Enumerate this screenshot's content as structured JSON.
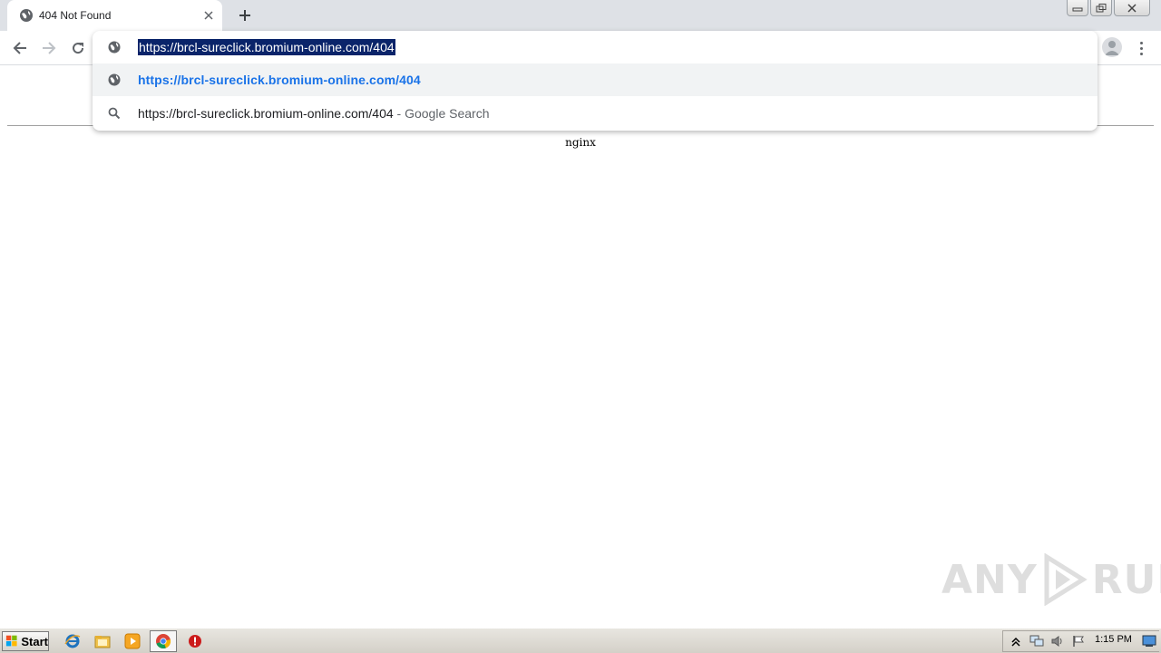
{
  "tab": {
    "title": "404 Not Found",
    "favicon": "globe-icon",
    "close_icon": "close-icon"
  },
  "newtab": {
    "icon": "plus-icon"
  },
  "window_controls": {
    "minimize": "minimize-icon",
    "restore": "restore-icon",
    "close": "close-icon"
  },
  "toolbar": {
    "back": "arrow-left-icon",
    "forward": "arrow-right-icon",
    "reload": "reload-icon",
    "avatar": "person-icon",
    "menu": "more-vertical-icon"
  },
  "omnibox": {
    "value": "https://brcl-sureclick.bromium-online.com/404",
    "suggestions": [
      {
        "icon": "globe-icon",
        "text": "https://brcl-sureclick.bromium-online.com/404"
      },
      {
        "icon": "search-icon",
        "text": "https://brcl-sureclick.bromium-online.com/404",
        "suffix": " - Google Search"
      }
    ]
  },
  "page": {
    "server": "nginx"
  },
  "watermark": {
    "left": "ANY",
    "right": "RUN"
  },
  "taskbar": {
    "start_label": "Start",
    "apps": [
      "internet-explorer-icon",
      "folder-icon",
      "media-player-icon",
      "chrome-icon",
      "stop-icon"
    ],
    "clock": "1:15 PM"
  },
  "colors": {
    "tabstrip": "#dee1e6",
    "selection": "#0a246a",
    "link": "#1a73e8",
    "taskbar": "#d4d0c8"
  }
}
